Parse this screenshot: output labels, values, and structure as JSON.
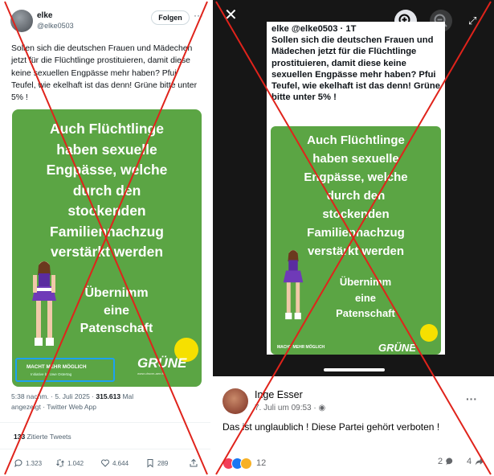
{
  "tweet": {
    "user_name": "elke",
    "user_handle": "@elke0503",
    "follow_label": "Folgen",
    "more_label": "···",
    "text": "Sollen sich die deutschen Frauen und Mädechen jetzt für die Flüchtlinge prostituieren, damit diese keine sexuellen Engpässe mehr haben? Pfui Teufel, wie ekelhaft ist das denn! Grüne bitte unter 5% !",
    "meta_time": "5:38 nachm. · 5. Juli 2025 · ",
    "meta_views": "315.613",
    "meta_views_suffix": " Mal",
    "meta_line2": "angezeigt · Twitter Web App",
    "quotes_count": "133",
    "quotes_label": " Zitierte Tweets",
    "reply_count": "1.323",
    "retweet_count": "1.042",
    "like_count": "4.644",
    "bookmark_count": "289"
  },
  "poster": {
    "headline_lines": [
      "Auch Flüchtlinge",
      "haben sexuelle",
      "Engpässe, welche",
      "durch den",
      "stockenden",
      "Familiennachzug",
      "verstärkt werden"
    ],
    "sub_lines": [
      "Übernimm",
      "eine",
      "Patenschaft"
    ],
    "slogan": "MACHT MEHR MÖGLICH",
    "slogan_sub": "Initiative by Uwe Ostertag",
    "brand": "GRÜNE",
    "brand_url": "www.uhsvm-aen.fr"
  },
  "fb_viewer": {
    "close_label": "✕",
    "shot_header": "elke @elke0503 · 1T",
    "shot_text": "Sollen sich die deutschen Frauen und Mädechen jetzt für die Flüchtlinge prostituieren, damit diese keine sexuellen Engpässe mehr haben? Pfui Teufel, wie ekelhaft ist das denn! Grüne bitte unter 5% !",
    "slogan": "MACHT MEHR MÖGLICH",
    "brand": "GRÜNE"
  },
  "fb_post": {
    "author": "Inge Esser",
    "time": "7. Juli um 09:53 · ",
    "more_label": "···",
    "text": "Das ist unglaublich ! Diese Partei gehört verboten !",
    "reaction_count": "12",
    "comment_count": "2",
    "share_count": "4"
  },
  "colors": {
    "poster_green": "#5ba544",
    "cross_red": "#e0231b",
    "highlight_blue": "#1da1f2",
    "viewer_bg": "#161616"
  }
}
